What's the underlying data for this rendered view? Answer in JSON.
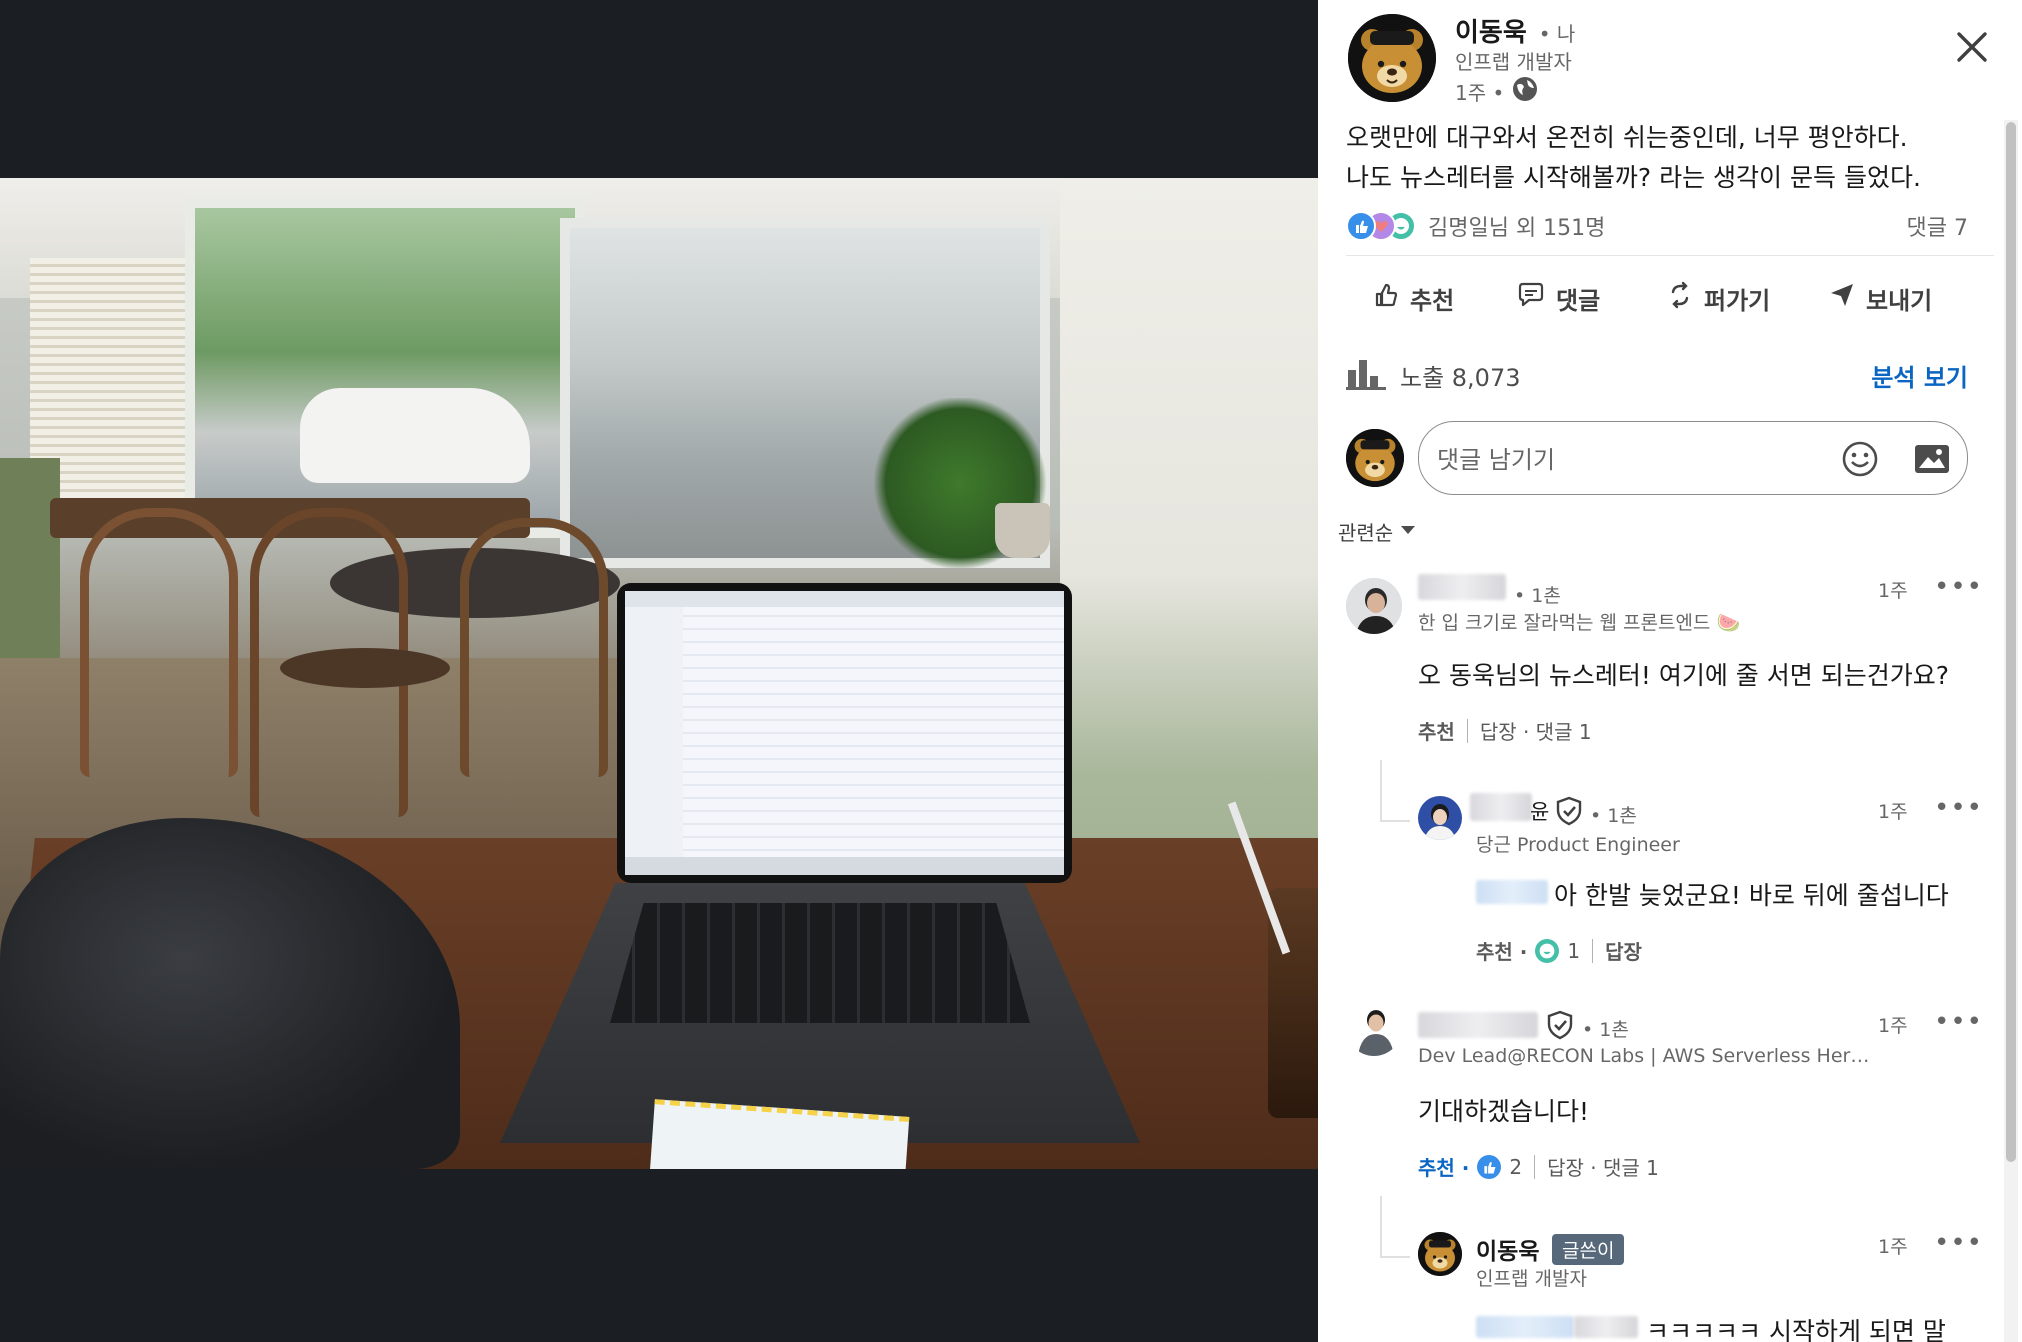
{
  "post": {
    "author": "이동욱",
    "degree": "• 나",
    "headline": "인프랩 개발자",
    "time": "1주 •",
    "body_line1": "오랫만에 대구와서 온전히 쉬는중인데, 너무 평안하다.",
    "body_line2": "나도 뉴스레터를 시작해볼까? 라는 생각이 문득 들었다.",
    "reactions_text": "김명일님 외 151명",
    "comments_count": "댓글 7"
  },
  "actions": {
    "like": "추천",
    "comment": "댓글",
    "repost": "퍼가기",
    "send": "보내기"
  },
  "analytics": {
    "impressions": "노출 8,073",
    "view_link": "분석 보기"
  },
  "comment_box": {
    "placeholder": "댓글 남기기"
  },
  "sort": {
    "label": "관련순"
  },
  "comments": [
    {
      "degree": "• 1촌",
      "headline": "한 입 크기로 잘라먹는 웹 프론트엔드 🍉",
      "time": "1주",
      "body": "오 동욱님의 뉴스레터! 여기에 줄 서면 되는건가요?",
      "like": "추천",
      "reply": "답장 · 댓글 1",
      "reply_item": {
        "name_suffix": "윤",
        "degree": "• 1촌",
        "headline": "당근 Product Engineer",
        "time": "1주",
        "body": "아 한발 늦었군요! 바로 뒤에 줄섭니다",
        "like": "추천 ·",
        "like_count": "1",
        "reply": "답장"
      }
    },
    {
      "degree": "• 1촌",
      "headline": "Dev Lead@RECON Labs | AWS Serverless Her…",
      "time": "1주",
      "body": "기대하겠습니다!",
      "like": "추천 ·",
      "like_count": "2",
      "reply": "답장 · 댓글 1",
      "reply_item": {
        "name": "이동욱",
        "badge": "글쓴이",
        "headline": "인프랩 개발자",
        "time": "1주",
        "body": "ㅋㅋㅋㅋㅋ 시작하게 되면 말"
      }
    }
  ],
  "icons": {
    "close": "close-icon",
    "globe": "globe-icon",
    "more": "more-icon"
  },
  "colors": {
    "accent_blue": "#0a66c2",
    "viewer_bg": "#1b1f23"
  }
}
